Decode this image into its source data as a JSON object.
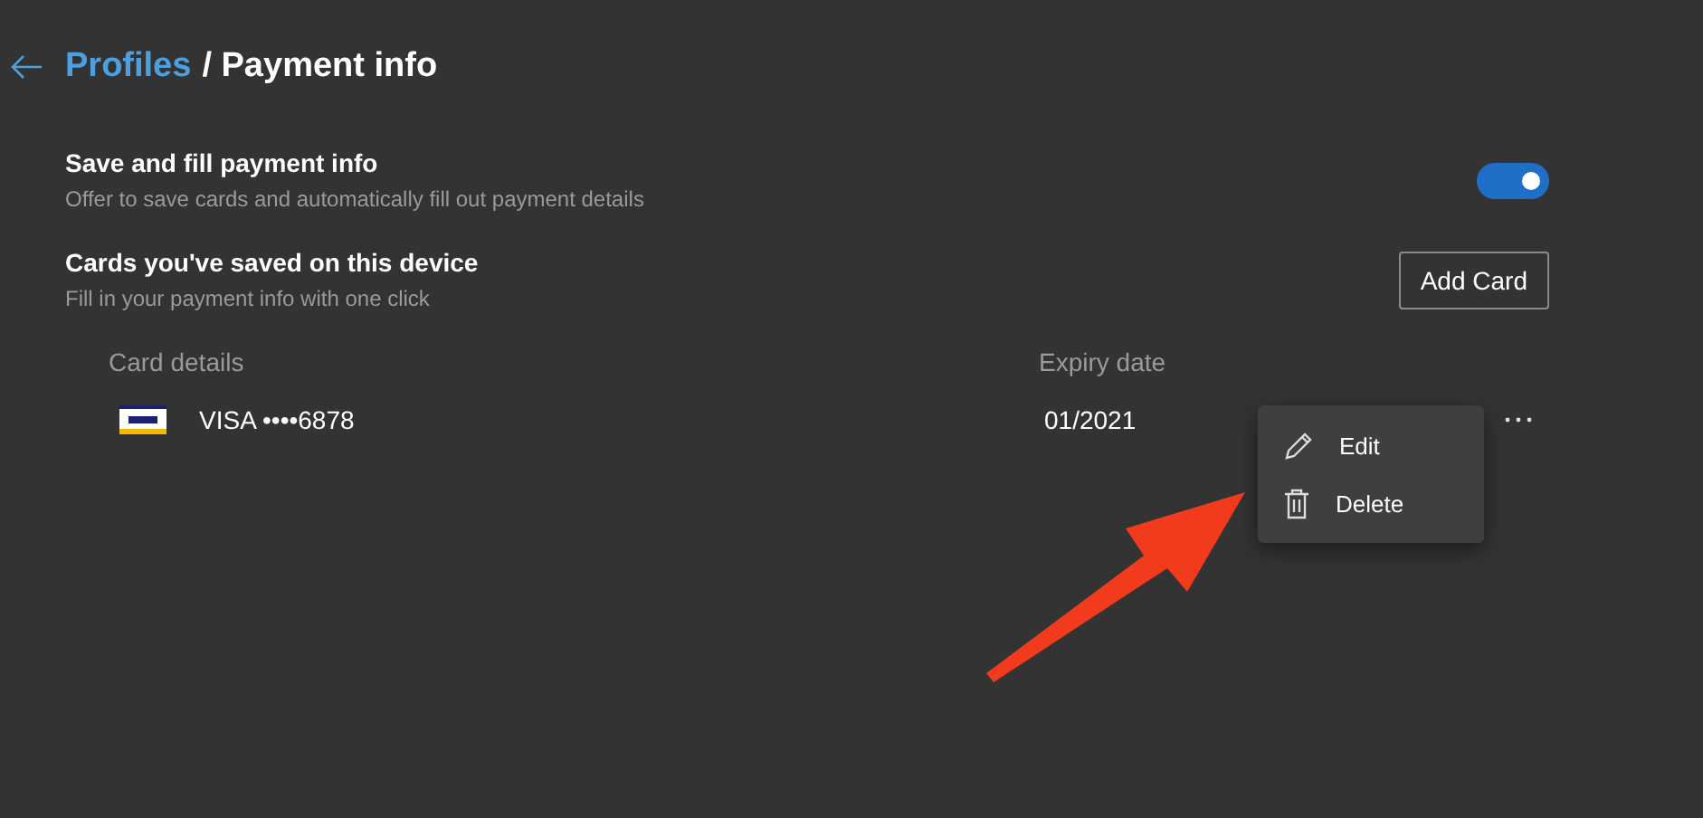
{
  "header": {
    "link": "Profiles",
    "title": "/ Payment info"
  },
  "autofill": {
    "title": "Save and fill payment info",
    "description": "Offer to save cards and automatically fill out payment details",
    "on": true
  },
  "saved_cards": {
    "title": "Cards you've saved on this device",
    "description": "Fill in your payment info with one click",
    "button": "Add Card"
  },
  "table": {
    "columns": [
      "Card details",
      "Expiry date"
    ],
    "rows": [
      {
        "card": "VISA ••••6878",
        "expiry": "01/2021",
        "menu_open": true
      }
    ]
  },
  "menu": {
    "items": [
      {
        "kind": "edit",
        "label": "Edit"
      },
      {
        "kind": "delete",
        "label": "Delete"
      }
    ]
  }
}
